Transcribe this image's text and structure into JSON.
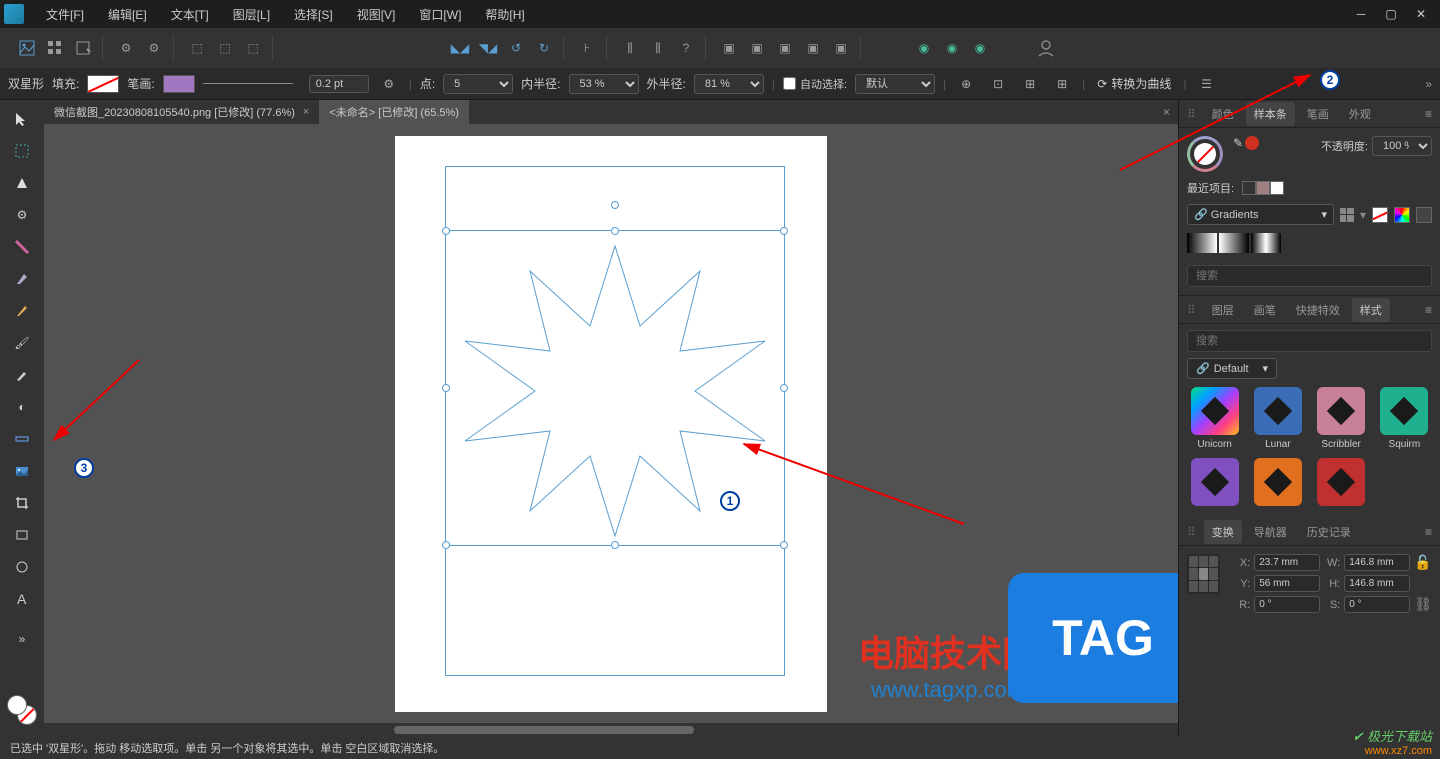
{
  "menu": {
    "file": "文件[F]",
    "edit": "编辑[E]",
    "text": "文本[T]",
    "layer": "图层[L]",
    "select": "选择[S]",
    "view": "视图[V]",
    "window": "窗口[W]",
    "help": "帮助[H]"
  },
  "context": {
    "shape": "双星形",
    "fill": "填充:",
    "stroke": "笔画:",
    "strokeWidth": "0.2 pt",
    "points": "点:",
    "pointsVal": "5",
    "innerR": "内半径:",
    "innerRVal": "53 %",
    "outerR": "外半径:",
    "outerRVal": "81 %",
    "autoSelect": "自动选择:",
    "autoSelectVal": "默认",
    "convert": "转换为曲线"
  },
  "tabs": {
    "t1": "微信截图_20230808105540.png [已修改] (77.6%)",
    "t2": "<未命名> [已修改] (65.5%)"
  },
  "rightTop": {
    "color": "颜色",
    "swatches": "样本条",
    "stroke": "笔画",
    "appearance": "外观",
    "opacity": "不透明度:",
    "opacityVal": "100 %",
    "recent": "最近项目:",
    "gradients": "Gradients",
    "search": "搜索"
  },
  "rightMid": {
    "layer": "图层",
    "brush": "画笔",
    "effects": "快捷特效",
    "style": "样式",
    "search": "搜索",
    "default": "Default",
    "unicorn": "Unicorn",
    "lunar": "Lunar",
    "scribbler": "Scribbler",
    "squirm": "Squirm"
  },
  "rightBot": {
    "transform": "变换",
    "navigator": "导航器",
    "history": "历史记录",
    "x": "X:",
    "xv": "23.7 mm",
    "y": "Y:",
    "yv": "56 mm",
    "w": "W:",
    "wv": "146.8 mm",
    "h": "H:",
    "hv": "146.8 mm",
    "r": "R:",
    "rv": "0 °",
    "s": "S:",
    "sv": "0 °"
  },
  "status": "已选中 '双星形'。拖动 移动选取项。单击 另一个对象将其选中。单击 空白区域取消选择。",
  "annotations": {
    "b1": "1",
    "b2": "2",
    "b3": "3"
  },
  "watermark": {
    "title": "电脑技术网",
    "url": "www.tagxp.com",
    "tag": "TAG",
    "dl1": "极光下载站",
    "dl2": "www.xz7.com"
  }
}
